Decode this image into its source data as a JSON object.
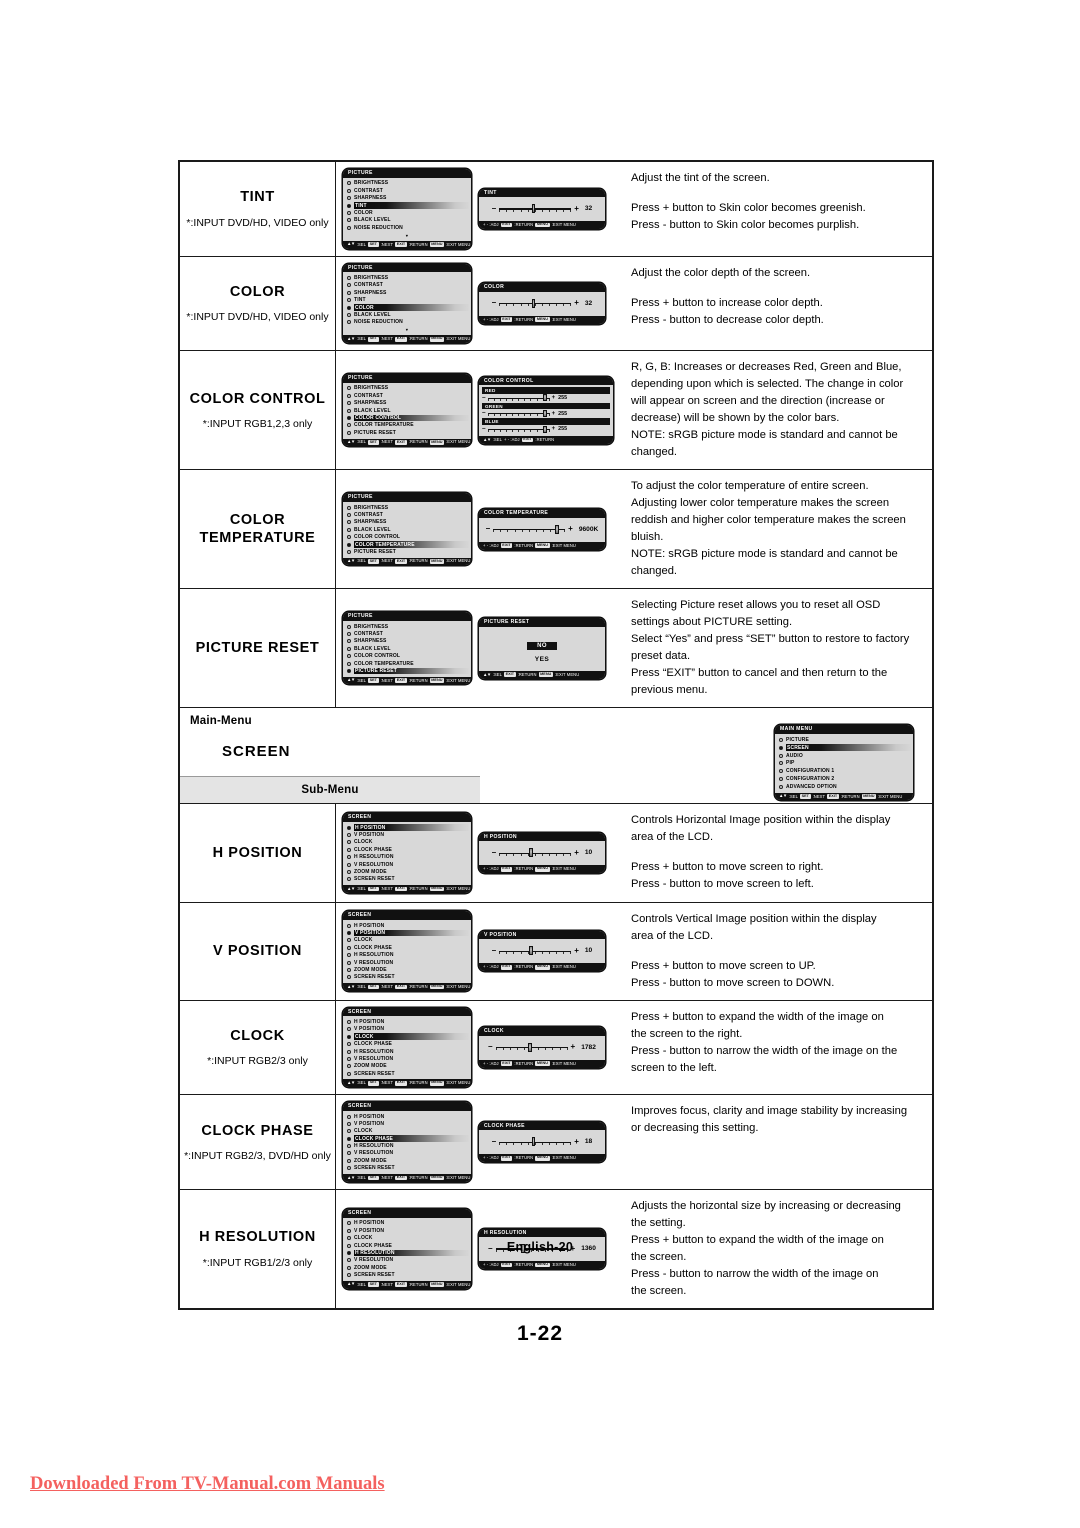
{
  "page": {
    "english_label": "English-20",
    "page_number": "1-22",
    "watermark": "Downloaded From TV-Manual.com Manuals",
    "accent_color": "#f4615f"
  },
  "osd_footer": {
    "sel_next_return_exit": [
      {
        "arrows": "▲▼",
        "text": ":SEL"
      },
      {
        "key": "SET",
        "text": ":NEXT"
      },
      {
        "key": "EXIT",
        "text": ":RETURN"
      },
      {
        "key": "MENU",
        "text": ":EXIT MENU"
      }
    ],
    "adj_return_exit": [
      {
        "text": "+ - :ADJ"
      },
      {
        "key": "EXIT",
        "text": ":RETURN"
      },
      {
        "key": "MENU",
        "text": ":EXIT MENU"
      }
    ],
    "sel_adj_return": [
      {
        "arrows": "▲▼",
        "text": ":SEL"
      },
      {
        "text": "+ - :ADJ"
      },
      {
        "key": "EXIT",
        "text": ":RETURN"
      }
    ],
    "sel_return_exit": [
      {
        "arrows": "▲▼",
        "text": ":SEL"
      },
      {
        "key": "EXIT",
        "text": ":RETURN"
      },
      {
        "key": "MENU",
        "text": ":EXIT MENU"
      }
    ]
  },
  "picture_menu": {
    "title": "PICTURE",
    "items_a": [
      "BRIGHTNESS",
      "CONTRAST",
      "SHARPNESS",
      "TINT",
      "COLOR",
      "BLACK LEVEL",
      "NOISE REDUCTION"
    ],
    "items_b": [
      "BRIGHTNESS",
      "CONTRAST",
      "SHARPNESS",
      "BLACK LEVEL",
      "COLOR CONTROL",
      "COLOR TEMPERATURE",
      "PICTURE RESET"
    ],
    "more_glyph": "▾"
  },
  "screen_menu": {
    "title": "SCREEN",
    "items": [
      "H POSITION",
      "V POSITION",
      "CLOCK",
      "CLOCK PHASE",
      "H RESOLUTION",
      "V RESOLUTION",
      "ZOOM MODE",
      "SCREEN RESET"
    ]
  },
  "main_menu": {
    "heading_main": "Main-Menu",
    "heading_screen": "SCREEN",
    "heading_sub": "Sub-Menu",
    "osd_title": "MAIN MENU",
    "items": [
      "PICTURE",
      "SCREEN",
      "AUDIO",
      "PIP",
      "CONFIGURATION 1",
      "CONFIGURATION 2",
      "ADVANCED OPTION"
    ],
    "selected": "SCREEN"
  },
  "rows": [
    {
      "id": "tint",
      "title": "TINT",
      "note": "*:INPUT DVD/HD, VIDEO only",
      "menu_title": "PICTURE",
      "menu_selected": "TINT",
      "adj_title": "TINT",
      "adj_value": "32",
      "desc": [
        {
          "text": "Adjust the tint of the screen."
        },
        {
          "text": "Press + button to Skin color becomes greenish.",
          "gap": true
        },
        {
          "text": "Press - button to Skin color becomes purplish."
        }
      ]
    },
    {
      "id": "color",
      "title": "COLOR",
      "note": "*:INPUT DVD/HD, VIDEO only",
      "menu_title": "PICTURE",
      "menu_selected": "COLOR",
      "adj_title": "COLOR",
      "adj_value": "32",
      "desc": [
        {
          "text": "Adjust the color depth of the screen."
        },
        {
          "text": "Press + button to increase color depth.",
          "gap": true
        },
        {
          "text": "Press - button to decrease color depth."
        }
      ]
    },
    {
      "id": "color-control",
      "title": "COLOR CONTROL",
      "note": "*:INPUT RGB1,2,3 only",
      "menu_title": "PICTURE",
      "menu_selected": "COLOR CONTROL",
      "adj_title": "COLOR CONTROL",
      "rgb": [
        {
          "label": "RED",
          "value": "255"
        },
        {
          "label": "GREEN",
          "value": "255"
        },
        {
          "label": "BLUE",
          "value": "255"
        }
      ],
      "desc": [
        {
          "text": "R, G, B: Increases or decreases Red, Green and Blue,"
        },
        {
          "text": "depending upon which is selected. The change in color"
        },
        {
          "text": "will appear on screen and the direction (increase or"
        },
        {
          "text": "decrease) will be shown by the color bars."
        },
        {
          "text": "NOTE: sRGB picture mode is standard and cannot be"
        },
        {
          "text": "changed."
        }
      ]
    },
    {
      "id": "color-temperature",
      "title": "COLOR\nTEMPERATURE",
      "note": "",
      "menu_title": "PICTURE",
      "menu_selected": "COLOR TEMPERATURE",
      "adj_title": "COLOR TEMPERATURE",
      "adj_value": "9600K",
      "desc": [
        {
          "text": "To adjust the color temperature of entire screen."
        },
        {
          "text": "Adjusting lower color temperature makes the screen"
        },
        {
          "text": "reddish and higher color temperature makes the screen"
        },
        {
          "text": "bluish."
        },
        {
          "text": "NOTE: sRGB picture mode is standard and cannot be"
        },
        {
          "text": "changed."
        }
      ]
    },
    {
      "id": "picture-reset",
      "title": "PICTURE RESET",
      "note": "",
      "menu_title": "PICTURE",
      "menu_selected": "PICTURE RESET",
      "adj_title": "PICTURE RESET",
      "choice_no": "NO",
      "choice_yes": "YES",
      "desc": [
        {
          "text": "Selecting Picture reset allows you to reset all OSD"
        },
        {
          "text": "settings about PICTURE setting."
        },
        {
          "text": "Select “Yes” and press “SET” button to restore to factory"
        },
        {
          "text": "preset data."
        },
        {
          "text": "Press “EXIT” button to cancel and then return to the"
        },
        {
          "text": "previous menu."
        }
      ]
    },
    {
      "id": "h-position",
      "title": "H POSITION",
      "note": "",
      "menu_title": "SCREEN",
      "menu_selected": "H POSITION",
      "adj_title": "H POSITION",
      "adj_value": "10",
      "desc": [
        {
          "text": "Controls Horizontal Image position within the display"
        },
        {
          "text": "area of the LCD."
        },
        {
          "text": "Press + button to move screen to right.",
          "gap": true
        },
        {
          "text": "Press - button to move screen to left."
        }
      ]
    },
    {
      "id": "v-position",
      "title": "V POSITION",
      "note": "",
      "menu_title": "SCREEN",
      "menu_selected": "V POSITION",
      "adj_title": "V POSITION",
      "adj_value": "10",
      "desc": [
        {
          "text": "Controls Vertical Image position within the display"
        },
        {
          "text": "area of the LCD."
        },
        {
          "text": "Press + button to move screen to UP.",
          "gap": true
        },
        {
          "text": "Press - button to move screen to DOWN."
        }
      ]
    },
    {
      "id": "clock",
      "title": "CLOCK",
      "note": "*:INPUT RGB2/3 only",
      "menu_title": "SCREEN",
      "menu_selected": "CLOCK",
      "adj_title": "CLOCK",
      "adj_value": "1782",
      "desc": [
        {
          "text": "Press + button to expand the width of the image on"
        },
        {
          "text": "the screen to the right."
        },
        {
          "text": "Press - button to narrow the width of the image on the"
        },
        {
          "text": "screen to the left."
        }
      ]
    },
    {
      "id": "clock-phase",
      "title": "CLOCK PHASE",
      "note": "*:INPUT RGB2/3, DVD/HD only",
      "menu_title": "SCREEN",
      "menu_selected": "CLOCK PHASE",
      "adj_title": "CLOCK PHASE",
      "adj_value": "18",
      "desc": [
        {
          "text": "Improves focus, clarity and image stability by increasing"
        },
        {
          "text": "or decreasing this setting."
        }
      ]
    },
    {
      "id": "h-resolution",
      "title": "H RESOLUTION",
      "note": "*:INPUT RGB1/2/3 only",
      "menu_title": "SCREEN",
      "menu_selected": "H RESOLUTION",
      "adj_title": "H RESOLUTION",
      "adj_value": "1360",
      "desc": [
        {
          "text": "Adjusts the horizontal size by increasing or decreasing"
        },
        {
          "text": "the setting."
        },
        {
          "text": "Press + button to expand the width of the image on"
        },
        {
          "text": "the screen."
        },
        {
          "text": "Press - button to narrow the width of the image on"
        },
        {
          "text": "the screen."
        }
      ]
    }
  ]
}
